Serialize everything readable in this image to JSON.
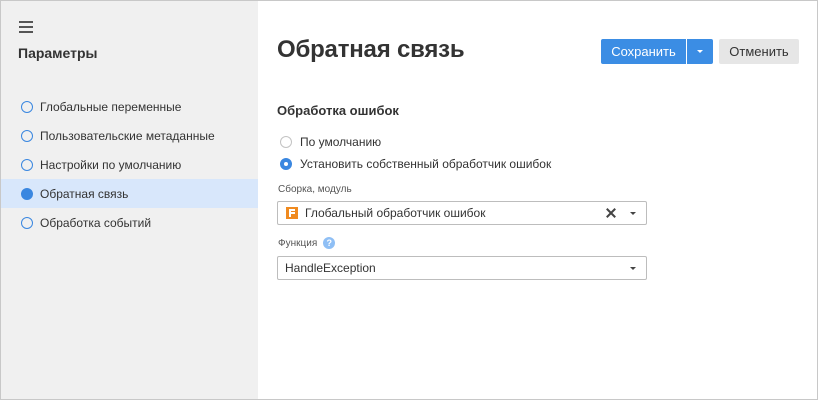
{
  "sidebar": {
    "title": "Параметры",
    "items": [
      {
        "label": "Глобальные переменные",
        "active": false
      },
      {
        "label": "Пользовательские метаданные",
        "active": false
      },
      {
        "label": "Настройки по умолчанию",
        "active": false
      },
      {
        "label": "Обратная связь",
        "active": true
      },
      {
        "label": "Обработка событий",
        "active": false
      }
    ]
  },
  "main": {
    "title": "Обратная связь",
    "save_label": "Сохранить",
    "cancel_label": "Отменить",
    "section_title": "Обработка ошибок",
    "options": [
      {
        "label": "По умолчанию",
        "checked": false
      },
      {
        "label": "Установить собственный обработчик ошибок",
        "checked": true
      }
    ],
    "assembly": {
      "label": "Сборка, модуль",
      "value": "Глобальный обработчик ошибок"
    },
    "function": {
      "label": "Функция",
      "help": "?",
      "value": "HandleException"
    }
  },
  "colors": {
    "accent": "#3b8de4",
    "sidebar_bg": "#f0f0f0",
    "active_item_bg": "#d8e7fb",
    "module_icon": "#f08a1f"
  },
  "icons": [
    "menu-icon",
    "radio-icon",
    "caret-down-icon",
    "module-icon",
    "clear-icon",
    "help-icon"
  ]
}
